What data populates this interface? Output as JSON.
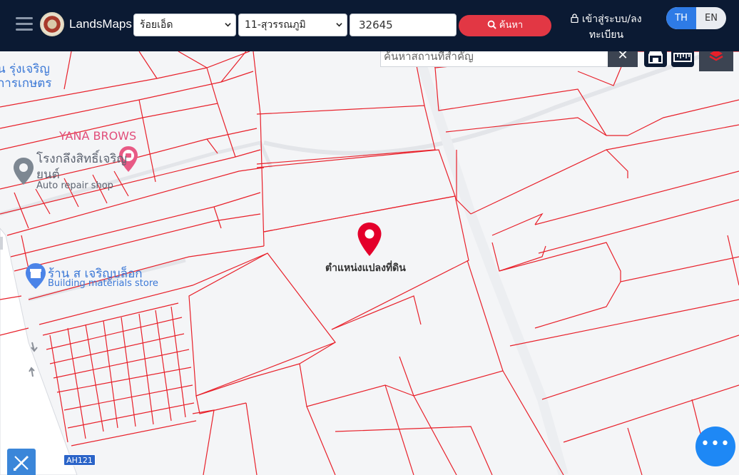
{
  "header": {
    "brand": "LandsMaps",
    "province_select": "ร้อยเอ็ด",
    "district_select": "11-สุวรรณภูมิ",
    "parcel_number": "32645",
    "search_label": "ค้นหา",
    "login_label": "เข้าสู่ระบบ/ลงทะเบียน",
    "lang_th": "TH",
    "lang_en": "EN"
  },
  "map": {
    "place_search_placeholder": "ค้นหาสถานที่สำคัญ",
    "clear_symbol": "✕",
    "pin_label": "ตำแหน่งแปลงที่ดิน",
    "road_shield": "AH121",
    "fab_symbol": "•••",
    "pois": [
      {
        "name": "YANA BROWS",
        "type": "beauty-salon"
      },
      {
        "name": "โรงกลึงสิทธิ์เจริญยนต์",
        "category": "Auto repair shop"
      },
      {
        "name": "ร้าน ส เจริญบล็อก",
        "category": "Building materials store"
      },
      {
        "name": "น รุ่งเจริญ การเกษตร",
        "category": ""
      }
    ]
  },
  "colors": {
    "header_bg": "#0b1a33",
    "search_button": "#e23744",
    "lang_active": "#2e7be6",
    "parcel_lines": "#e8202a",
    "pin": "#e4002b",
    "fab": "#1e88f5"
  }
}
